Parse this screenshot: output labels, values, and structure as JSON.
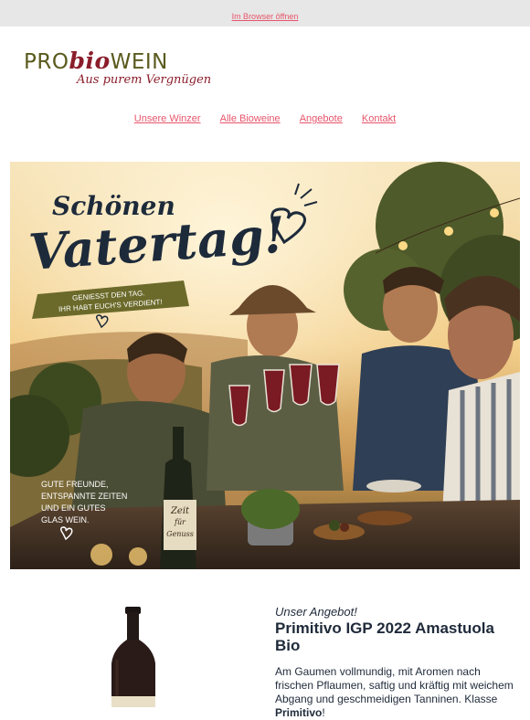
{
  "topbar": {
    "browser_link": "Im Browser öffnen"
  },
  "logo": {
    "part1": "PRO",
    "part2": "bio",
    "part3": "WEIN",
    "tagline": "Aus purem Vergnügen"
  },
  "nav": {
    "items": [
      "Unsere Winzer",
      "Alle Bioweine",
      "Angebote",
      "Kontakt"
    ]
  },
  "hero": {
    "headline_1": "Schönen",
    "headline_2": "Vatertag!",
    "banner_1": "GENIESST DEN TAG.",
    "banner_2": "IHR HABT EUCH'S VERDIENT!",
    "caption_1": "GUTE FREUNDE,",
    "caption_2": "ENTSPANNTE ZEITEN",
    "caption_3": "UND EIN GUTES",
    "caption_4": "GLAS WEIN.",
    "bottle_label_1": "Zeit",
    "bottle_label_2": "für",
    "bottle_label_3": "Genuss"
  },
  "offer": {
    "kicker": "Unser Angebot!",
    "title": "Primitivo IGP 2022 Amastuola Bio",
    "desc_prefix": "Am Gaumen vollmundig, mit Aromen nach frischen Pflaumen, saftig und kräftig mit weichem Abgang und geschmeidigen Tanninen. Klasse ",
    "desc_bold": "Primitivo",
    "desc_suffix": "!"
  },
  "colors": {
    "link": "#e7556b",
    "brand_olive": "#5a5a1e",
    "brand_red": "#8b1d2b",
    "text_dark": "#1f2a3a"
  }
}
